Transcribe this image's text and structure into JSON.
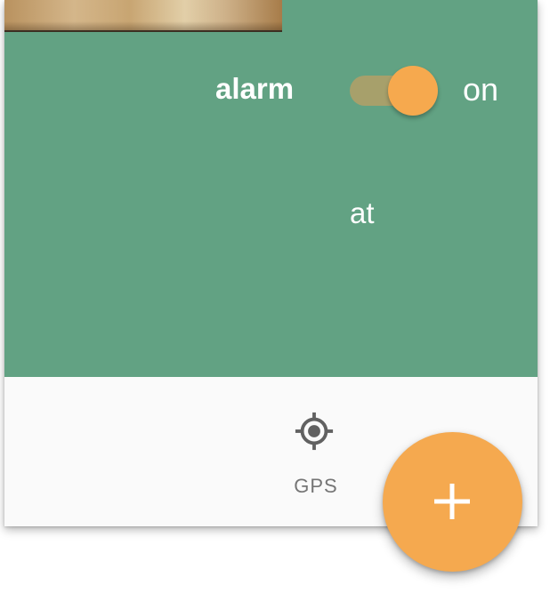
{
  "alarm": {
    "label": "alarm",
    "state_label": "on",
    "enabled": true
  },
  "schedule": {
    "at_label": "at"
  },
  "bottom_bar": {
    "gps": {
      "icon": "gps-crosshair-icon",
      "label": "GPS"
    }
  },
  "fab": {
    "icon": "plus-icon"
  },
  "colors": {
    "panel_green": "#62a283",
    "accent_orange": "#f5a94f",
    "toggle_track": "#a7a06b",
    "icon_gray": "#616161"
  }
}
